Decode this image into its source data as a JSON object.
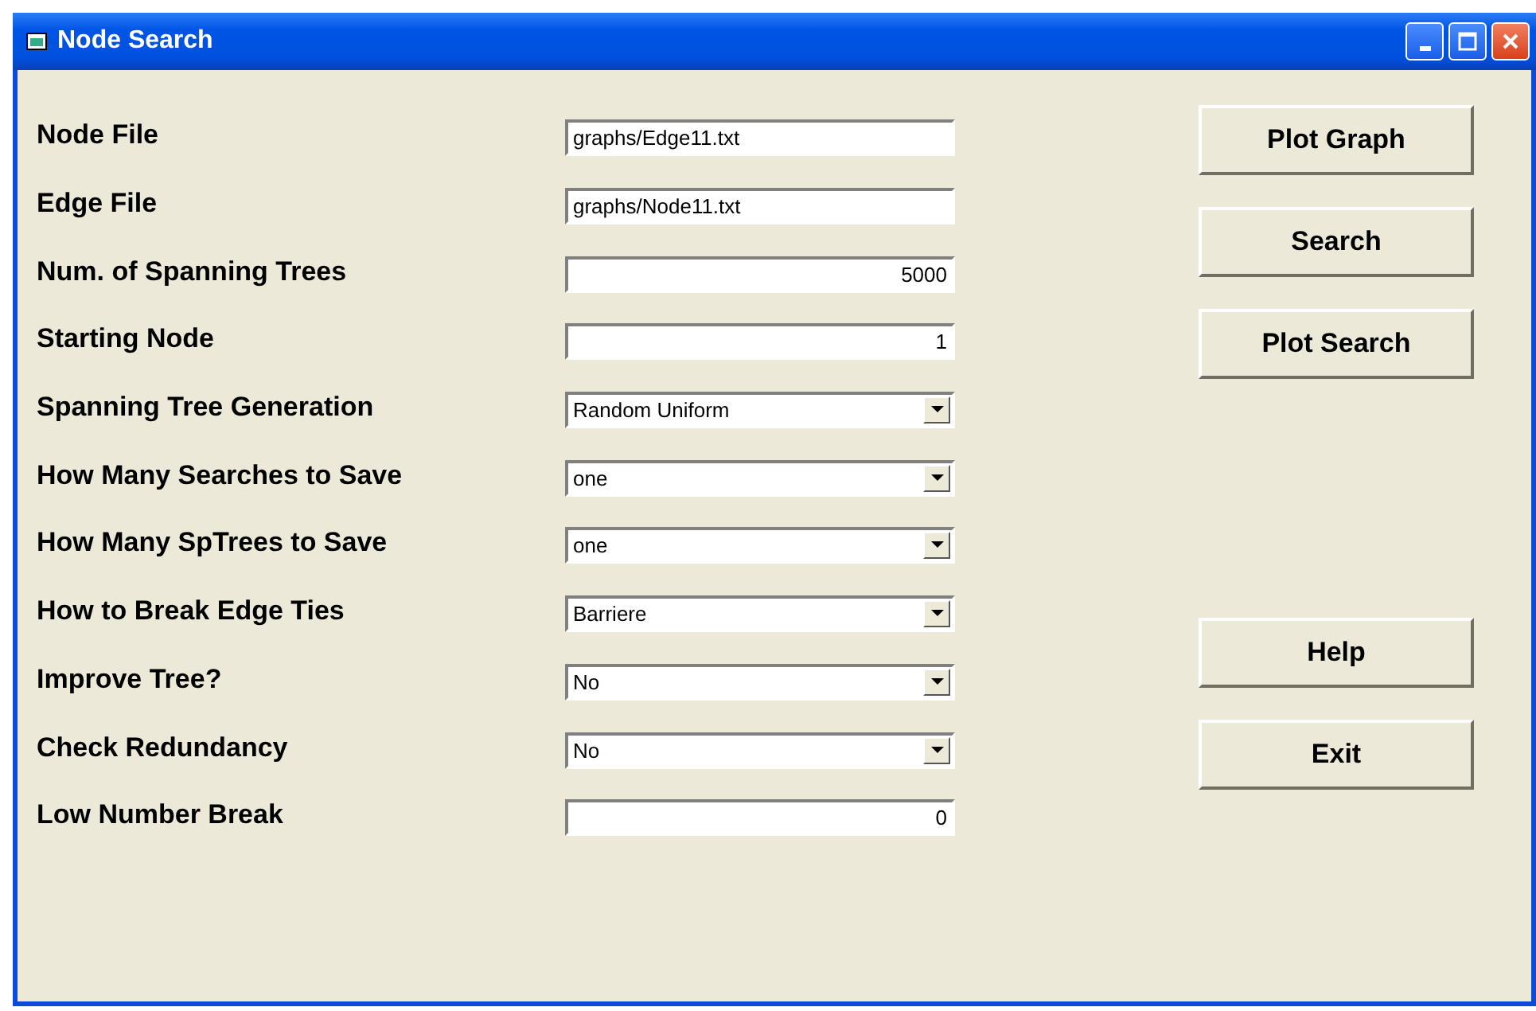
{
  "window": {
    "title": "Node Search"
  },
  "fields": [
    {
      "label": "Node File",
      "kind": "text",
      "value": "graphs/Edge11.txt"
    },
    {
      "label": "Edge File",
      "kind": "text",
      "value": "graphs/Node11.txt"
    },
    {
      "label": "Num. of Spanning Trees",
      "kind": "number",
      "value": "5000"
    },
    {
      "label": "Starting Node",
      "kind": "number",
      "value": "1"
    },
    {
      "label": "Spanning Tree Generation",
      "kind": "dropdown",
      "value": "Random Uniform"
    },
    {
      "label": "How Many Searches to Save",
      "kind": "dropdown",
      "value": "one"
    },
    {
      "label": "How Many SpTrees to Save",
      "kind": "dropdown",
      "value": "one"
    },
    {
      "label": "How to Break Edge Ties",
      "kind": "dropdown",
      "value": "Barriere"
    },
    {
      "label": "Improve Tree?",
      "kind": "dropdown",
      "value": "No"
    },
    {
      "label": "Check Redundancy",
      "kind": "dropdown",
      "value": "No"
    },
    {
      "label": "Low Number Break",
      "kind": "number",
      "value": "0"
    }
  ],
  "buttons_top": [
    "Plot Graph",
    "Search",
    "Plot Search"
  ],
  "buttons_bottom": [
    "Help",
    "Exit"
  ]
}
